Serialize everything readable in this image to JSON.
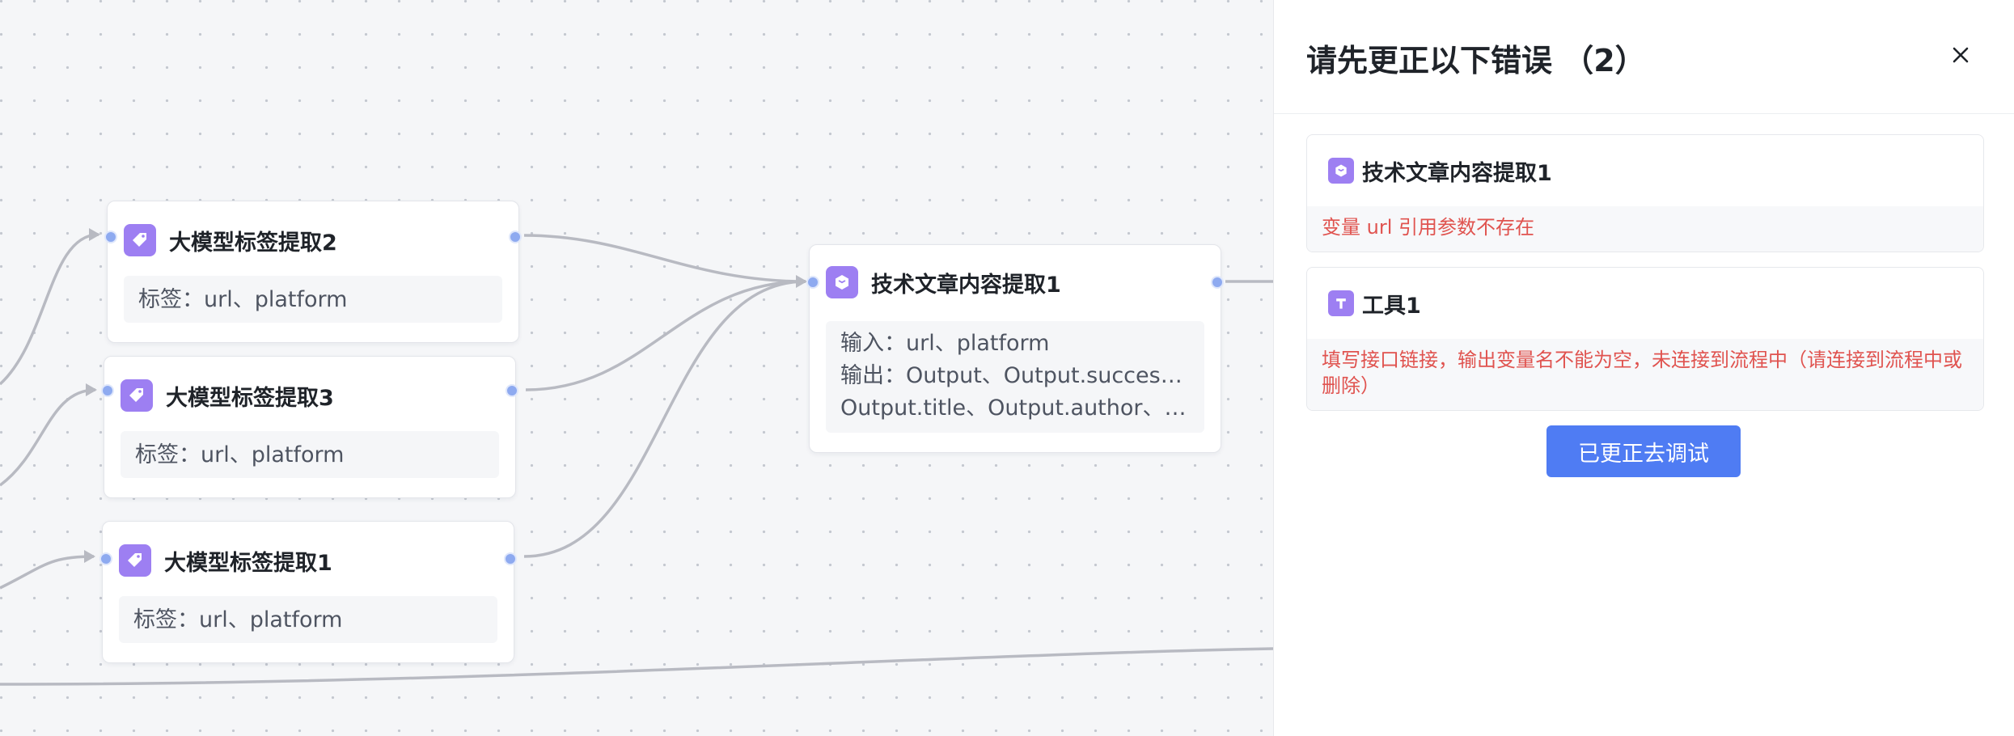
{
  "colors": {
    "accent": "#4f7cf3",
    "node_icon": "#9d7ff2",
    "error_text": "#e0534f",
    "edge": "#b8bac2",
    "port": "#8eaaf0"
  },
  "canvas": {
    "nodes": [
      {
        "title": "大模型标签提取2",
        "icon": "tag-icon",
        "rows": [
          "标签：url、platform"
        ]
      },
      {
        "title": "大模型标签提取3",
        "icon": "tag-icon",
        "rows": [
          "标签：url、platform"
        ]
      },
      {
        "title": "大模型标签提取1",
        "icon": "tag-icon",
        "rows": [
          "标签：url、platform"
        ]
      },
      {
        "title": "技术文章内容提取1",
        "icon": "cube-icon",
        "rows": [
          "输入：url、platform",
          "输出：Output、Output.success、",
          "Output.title、Output.author、O..."
        ]
      }
    ]
  },
  "panel": {
    "title": "请先更正以下错误 （2）",
    "close_icon": "close-icon",
    "errors": [
      {
        "title": "技术文章内容提取1",
        "icon": "cube-icon",
        "message": "变量 url 引用参数不存在"
      },
      {
        "title": "工具1",
        "icon": "tool-icon",
        "message": "填写接口链接，输出变量名不能为空，未连接到流程中（请连接到流程中或删除）"
      }
    ],
    "fixed_button": "已更正去调试"
  }
}
